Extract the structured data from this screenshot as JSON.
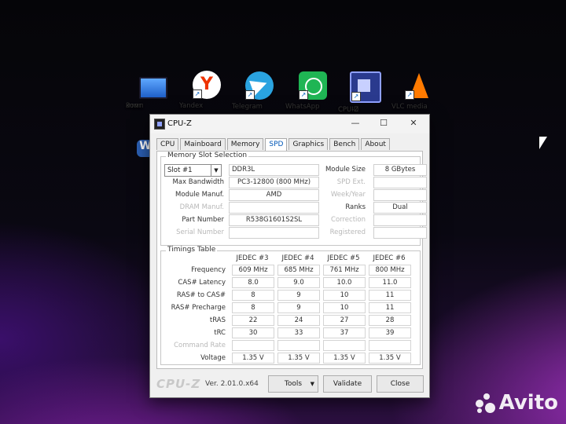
{
  "desktop": {
    "icons": [
      {
        "label": "Этот",
        "label2": "комп"
      },
      {
        "label": "Yandex"
      },
      {
        "label": "Telegram"
      },
      {
        "label": "WhatsApp"
      },
      {
        "label": "CPUID",
        "label2": "CPU-Z"
      },
      {
        "label": "VLC media"
      },
      {
        "label": "W"
      }
    ]
  },
  "window": {
    "title": "CPU-Z",
    "minimize": "—",
    "maximize": "☐",
    "close": "✕",
    "tabs": [
      "CPU",
      "Mainboard",
      "Memory",
      "SPD",
      "Graphics",
      "Bench",
      "About"
    ],
    "active_tab": "SPD"
  },
  "slot": {
    "group_title": "Memory Slot Selection",
    "selected": "Slot #1",
    "type": "DDR3L",
    "module_size_label": "Module Size",
    "module_size": "8 GBytes",
    "max_bandwidth_label": "Max Bandwidth",
    "max_bandwidth": "PC3-12800 (800 MHz)",
    "spd_ext_label": "SPD Ext.",
    "module_manuf_label": "Module Manuf.",
    "module_manuf": "AMD",
    "week_year_label": "Week/Year",
    "dram_manuf_label": "DRAM Manuf.",
    "ranks_label": "Ranks",
    "ranks": "Dual",
    "part_number_label": "Part Number",
    "part_number": "R538G1601S2SL",
    "correction_label": "Correction",
    "serial_number_label": "Serial Number",
    "registered_label": "Registered"
  },
  "timings": {
    "group_title": "Timings Table",
    "headers": [
      "JEDEC #3",
      "JEDEC #4",
      "JEDEC #5",
      "JEDEC #6"
    ],
    "rows": [
      {
        "label": "Frequency",
        "values": [
          "609 MHz",
          "685 MHz",
          "761 MHz",
          "800 MHz"
        ]
      },
      {
        "label": "CAS# Latency",
        "values": [
          "8.0",
          "9.0",
          "10.0",
          "11.0"
        ]
      },
      {
        "label": "RAS# to CAS#",
        "values": [
          "8",
          "9",
          "10",
          "11"
        ]
      },
      {
        "label": "RAS# Precharge",
        "values": [
          "8",
          "9",
          "10",
          "11"
        ]
      },
      {
        "label": "tRAS",
        "values": [
          "22",
          "24",
          "27",
          "28"
        ]
      },
      {
        "label": "tRC",
        "values": [
          "30",
          "33",
          "37",
          "39"
        ]
      },
      {
        "label": "Command Rate",
        "values": [
          "",
          "",
          "",
          ""
        ]
      },
      {
        "label": "Voltage",
        "values": [
          "1.35 V",
          "1.35 V",
          "1.35 V",
          "1.35 V"
        ]
      }
    ]
  },
  "footer": {
    "brand": "CPU-Z",
    "version": "Ver. 2.01.0.x64",
    "tools": "Tools",
    "validate": "Validate",
    "close": "Close"
  },
  "watermark": "Avito"
}
